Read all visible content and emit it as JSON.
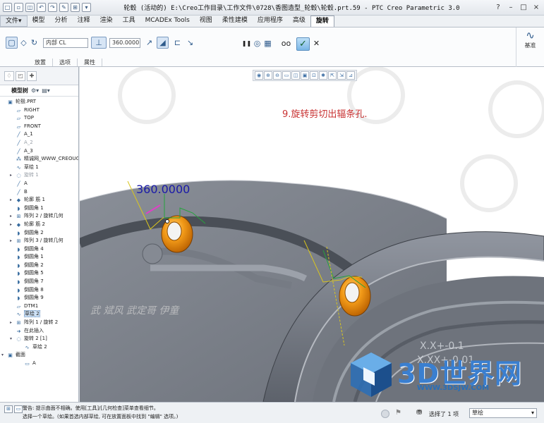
{
  "window": {
    "title": "轮毂 (活动的) E:\\Creo工作目录\\工作文件\\0728\\香图造型_轮毂\\轮毂.prt.59 - PTC Creo Parametric 3.0",
    "quick_access": [
      "□",
      "▫",
      "◫",
      "↶",
      "↷",
      "✎",
      "⊞",
      "▾"
    ],
    "controls": [
      "?",
      "–",
      "□",
      "×"
    ]
  },
  "menu": {
    "tabs": [
      "文件▾",
      "模型",
      "分析",
      "注释",
      "渲染",
      "工具",
      "MCADEx Tools",
      "视图",
      "柔性建模",
      "应用程序",
      "高级",
      "旋转"
    ],
    "active_tab": "旋转"
  },
  "ribbon": {
    "axis_field": "内部 CL",
    "angle_value": "360.0000",
    "subtabs": [
      "放置",
      "选项",
      "属性"
    ],
    "right_panel_label": "基准",
    "icons": {
      "solid": "▢",
      "surface": "◇",
      "axis": "↻",
      "angle_type": "⊥",
      "flip": "↗",
      "remove_material": "◢",
      "thicken": "⊏",
      "flip2": "↘",
      "pause": "❚❚",
      "stop": "◎",
      "preview": "▦",
      "verify": "oo",
      "ok": "✓",
      "cancel": "✕",
      "datum": "∿"
    }
  },
  "left_panel": {
    "tabs": [
      "♢",
      "◰",
      "✚"
    ],
    "header_label": "模型树",
    "tree": [
      {
        "label": "轮毂.PRT",
        "icon": "▣",
        "indent": 0
      },
      {
        "label": "RIGHT",
        "icon": "▱",
        "indent": 1
      },
      {
        "label": "TOP",
        "icon": "▱",
        "indent": 1
      },
      {
        "label": "FRONT",
        "icon": "▱",
        "indent": 1
      },
      {
        "label": "A_1",
        "icon": "╱",
        "indent": 1
      },
      {
        "label": "A_2",
        "icon": "╱",
        "indent": 1,
        "dim": true
      },
      {
        "label": "A_3",
        "icon": "╱",
        "indent": 1
      },
      {
        "label": "精诚网_WWW_CREOUG_COM",
        "icon": "⁂",
        "indent": 1
      },
      {
        "label": "草绘 1",
        "icon": "∿",
        "indent": 1
      },
      {
        "label": "旋转 1",
        "icon": "◌",
        "indent": 1,
        "expand": true,
        "dim": true
      },
      {
        "label": "A",
        "icon": "╱",
        "indent": 1
      },
      {
        "label": "B",
        "icon": "╱",
        "indent": 1
      },
      {
        "label": "轮廓 筋 1",
        "icon": "◆",
        "indent": 1,
        "expand": true
      },
      {
        "label": "倒圆角 1",
        "icon": "◗",
        "indent": 1
      },
      {
        "label": "阵列 2 / 旋转几何",
        "icon": "⊞",
        "indent": 1,
        "expand": true
      },
      {
        "label": "轮廓 筋 2",
        "icon": "◆",
        "indent": 1,
        "expand": true
      },
      {
        "label": "倒圆角 2",
        "icon": "◗",
        "indent": 1
      },
      {
        "label": "阵列 3 / 旋转几何",
        "icon": "⊞",
        "indent": 1,
        "expand": true
      },
      {
        "label": "倒圆角 4",
        "icon": "◗",
        "indent": 1
      },
      {
        "label": "倒圆角 1",
        "icon": "◗",
        "indent": 1
      },
      {
        "label": "倒圆角 2",
        "icon": "◗",
        "indent": 1
      },
      {
        "label": "倒圆角 5",
        "icon": "◗",
        "indent": 1
      },
      {
        "label": "倒圆角 7",
        "icon": "◗",
        "indent": 1
      },
      {
        "label": "倒圆角 8",
        "icon": "◗",
        "indent": 1
      },
      {
        "label": "倒圆角 9",
        "icon": "◗",
        "indent": 1
      },
      {
        "label": "DTM1",
        "icon": "▱",
        "indent": 1
      },
      {
        "label": "草绘 2",
        "icon": "∿",
        "indent": 1,
        "selected": true
      },
      {
        "label": "阵列 1 / 旋转 2",
        "icon": "⊞",
        "indent": 1,
        "expand": true
      },
      {
        "label": "在此插入",
        "icon": "➜",
        "indent": 1
      },
      {
        "label": "旋转 2 [1]",
        "icon": "◌",
        "indent": 1,
        "expand_open": true
      },
      {
        "label": "草绘 2",
        "icon": "∿",
        "indent": 2
      },
      {
        "label": "截面",
        "icon": "▣",
        "indent": 0,
        "expand_open": true
      },
      {
        "label": "A",
        "icon": "▭",
        "indent": 2
      }
    ]
  },
  "viewport": {
    "caption": "9.旋转剪切出辐条孔.",
    "dimension": "360.0000",
    "watermark_text": "武 斌风 武定哥 伊童",
    "tolerance_1": "X.X+-0.1",
    "tolerance_2": "X.XX+-0.01",
    "logo_title": "3D世界网",
    "logo_url": "WWW.3DSJW.COM",
    "view_icons": [
      "◉",
      "⊕",
      "⊖",
      "▭",
      "◫",
      "▣",
      "⊡",
      "✱",
      "⇱",
      "⇲",
      "⊿"
    ]
  },
  "status": {
    "messages": [
      "警告: 提示曲面不相确。使用[工具]/[几何检查]菜单查看细节。",
      "选择一个草绘。(如果首选内部草绘, 可在放置面板中找到 \"编辑\" 选项。)"
    ],
    "selection_count": "选择了 1 项",
    "filter": "草绘",
    "icons": [
      "⊞",
      "▭"
    ]
  },
  "colors": {
    "accent": "#2b5797",
    "model_gray": "#7b8089",
    "feature_orange": "#e8860f",
    "caption_red": "#c83232",
    "dimension_blue": "#1a1aa8"
  }
}
